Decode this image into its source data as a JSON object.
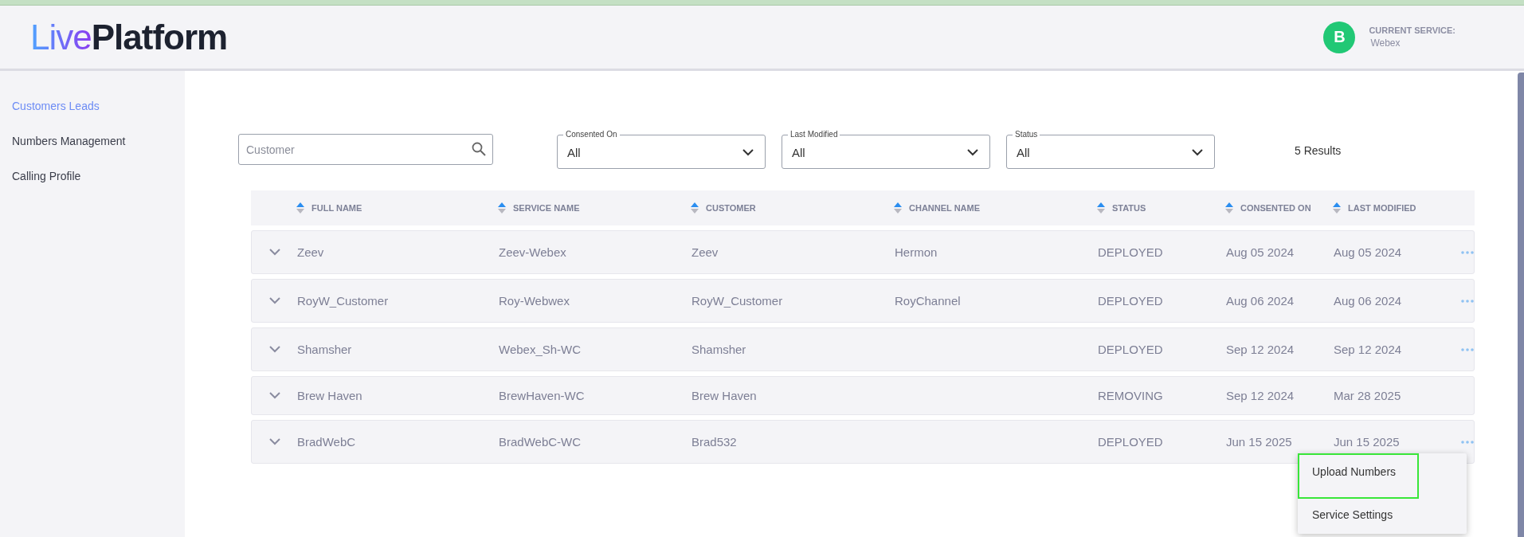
{
  "header": {
    "logo": {
      "accent": "Live",
      "rest": "Platform"
    },
    "avatar": "B",
    "current_service_label": "CURRENT SERVICE:",
    "current_service": "Webex"
  },
  "sidebar": {
    "items": [
      {
        "label": "Customers Leads",
        "selected": true
      },
      {
        "label": "Numbers Management",
        "selected": false
      },
      {
        "label": "Calling Profile",
        "selected": false
      }
    ]
  },
  "filters": {
    "search": {
      "placeholder": "Customer"
    },
    "dropdowns": [
      {
        "label": "Consented On",
        "value": "All"
      },
      {
        "label": "Last Modified",
        "value": "All"
      },
      {
        "label": "Status",
        "value": "All"
      }
    ],
    "results": "5 Results"
  },
  "table": {
    "columns": [
      "FULL NAME",
      "SERVICE NAME",
      "CUSTOMER",
      "CHANNEL NAME",
      "STATUS",
      "CONSENTED ON",
      "LAST MODIFIED"
    ],
    "rows": [
      {
        "cells": [
          "Zeev",
          "Zeev-Webex",
          "Zeev",
          "Hermon",
          "DEPLOYED",
          "Aug 05 2024",
          "Aug 05 2024"
        ],
        "has_actions": true
      },
      {
        "cells": [
          "RoyW_Customer",
          "Roy-Webwex",
          "RoyW_Customer",
          "RoyChannel",
          "DEPLOYED",
          "Aug 06 2024",
          "Aug 06 2024"
        ],
        "has_actions": true
      },
      {
        "cells": [
          "Shamsher",
          "Webex_Sh-WC",
          "Shamsher",
          "",
          "DEPLOYED",
          "Sep 12 2024",
          "Sep 12 2024"
        ],
        "has_actions": true
      },
      {
        "cells": [
          "Brew Haven",
          "BrewHaven-WC",
          "Brew Haven",
          "",
          "REMOVING",
          "Sep 12 2024",
          "Mar 28 2025"
        ],
        "has_actions": false
      },
      {
        "cells": [
          "BradWebC",
          "BradWebC-WC",
          "Brad532",
          "",
          "DEPLOYED",
          "Jun 15 2025",
          "Jun 15 2025"
        ],
        "has_actions": true,
        "action_menu": {
          "items": [
            {
              "label": "Upload Numbers",
              "focused": true
            },
            {
              "label": "Service Settings",
              "focused": false
            }
          ]
        }
      }
    ]
  }
}
